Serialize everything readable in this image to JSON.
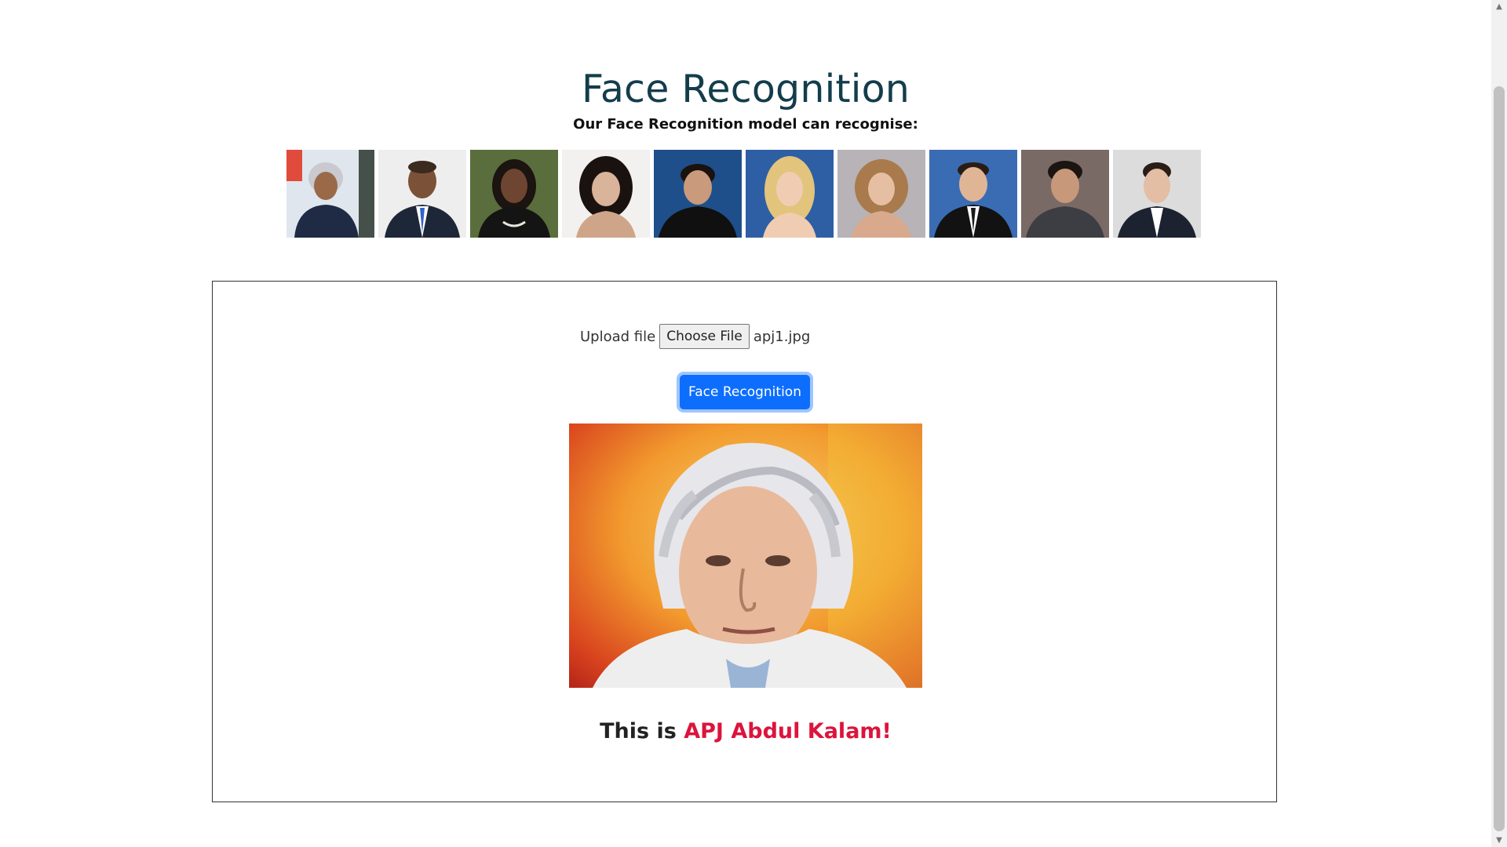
{
  "page": {
    "title": "Face Recognition",
    "subtitle": "Our Face Recognition model can recognise:"
  },
  "gallery": [
    {
      "icon": "portrait-thumbnail-1"
    },
    {
      "icon": "portrait-thumbnail-2"
    },
    {
      "icon": "portrait-thumbnail-3"
    },
    {
      "icon": "portrait-thumbnail-4"
    },
    {
      "icon": "portrait-thumbnail-5"
    },
    {
      "icon": "portrait-thumbnail-6"
    },
    {
      "icon": "portrait-thumbnail-7"
    },
    {
      "icon": "portrait-thumbnail-8"
    },
    {
      "icon": "portrait-thumbnail-9"
    },
    {
      "icon": "portrait-thumbnail-10"
    }
  ],
  "form": {
    "upload_label": "Upload file",
    "choose_file_label": "Choose File",
    "file_name": "apj1.jpg",
    "submit_label": "Face Recognition"
  },
  "result": {
    "prefix": "This is",
    "name": "APJ Abdul Kalam!"
  },
  "colors": {
    "title": "#143d4c",
    "button": "#0d6efd",
    "result_name": "#dc143c"
  }
}
